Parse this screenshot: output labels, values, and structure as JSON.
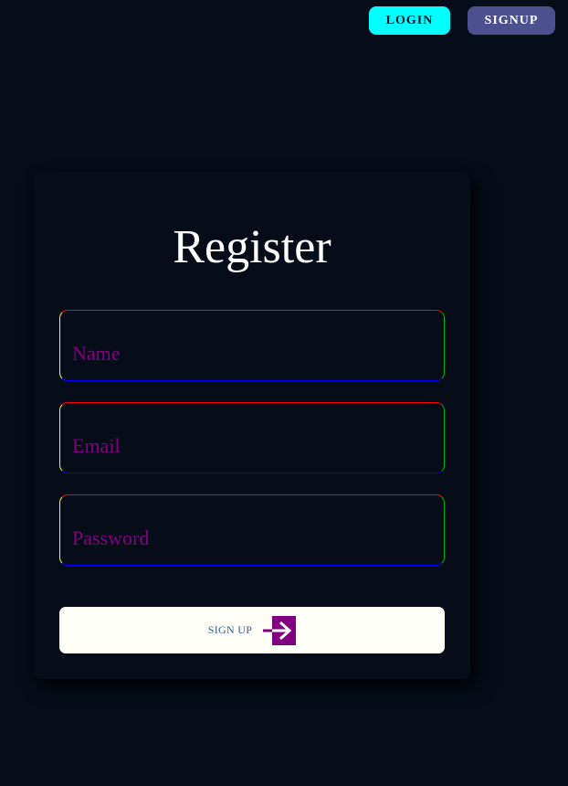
{
  "nav": {
    "login_label": "LOGIN",
    "signup_label": "SIGNUP"
  },
  "form": {
    "title": "Register",
    "name_placeholder": "Name",
    "email_placeholder": "Email",
    "password_placeholder": "Password",
    "submit_label": "SIGN UP",
    "submit_icon": "arrow-right-to-bracket-icon"
  },
  "colors": {
    "background": "#060d19",
    "login_button": "#00ffff",
    "signup_button": "#4d508f",
    "placeholder_text": "#800080",
    "icon": "#800080",
    "submit_button": "#fffff8",
    "submit_text": "#2f5f9a",
    "field_border_top": "#ff0000",
    "field_border_right": "#00b000",
    "field_border_bottom": "#0000ff",
    "field_border_left": "#ffff00"
  }
}
